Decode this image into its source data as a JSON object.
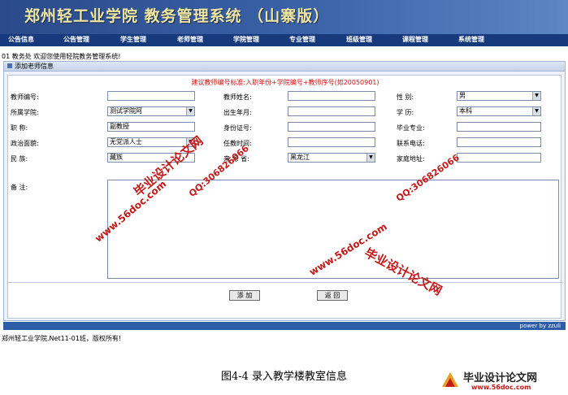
{
  "banner": {
    "title": "郑州轻工业学院  教务管理系统  （山寨版）"
  },
  "nav": [
    "公告信息",
    "公告管理",
    "学生管理",
    "老师管理",
    "学院管理",
    "专业管理",
    "班级管理",
    "课程管理",
    "系统管理"
  ],
  "welcome": "01 教务处 欢迎您使用轻院教务管理系统!",
  "panel_title": "添加老师信息",
  "form": {
    "hint": "建议教师编号标准:入职年份+学院编号+教师序号(如20050901)",
    "teacher_id_label": "教师编号:",
    "teacher_name_label": "教师姓名:",
    "gender_label": "性    别:",
    "gender_value": "男",
    "college_label": "所属学院:",
    "college_value": "测试学院阿",
    "birth_label": "出生年月:",
    "education_label": "学    历:",
    "education_value": "本科",
    "title_label": "职    称:",
    "title_value": "副教授",
    "idcard_label": "身份证号:",
    "major_label": "毕业专业:",
    "politics_label": "政治面貌:",
    "politics_value": "无党派人士",
    "start_label": "任教时间:",
    "phone_label": "联系电话:",
    "nation_label": "民    族:",
    "nation_value": "藏族",
    "province_label": "来 源 省:",
    "province_value": "黑龙江",
    "address_label": "家庭地址:",
    "remark_label": "备    注:",
    "add_button": "添 加",
    "back_button": "返 回"
  },
  "power_text": "power by zzuli",
  "footer": "郑州轻工业学院.Net11-01班，版权所有!",
  "caption": "图4-4  录入教学楼教室信息",
  "watermarks": {
    "site_name": "毕业设计论文网",
    "url": "www.56doc.com",
    "qq": "QQ:306826066"
  },
  "logo": {
    "name": "毕业设计论文网",
    "url": "www.56doc.com"
  },
  "colors": {
    "banner": "#2a4a8a",
    "nav": "#163a7c",
    "hint": "#d01010",
    "watermark": "#c41a1a"
  }
}
